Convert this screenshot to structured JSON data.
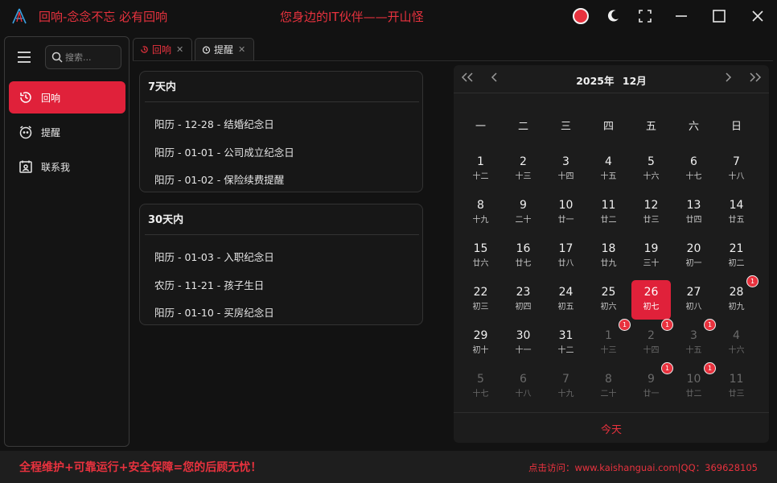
{
  "window": {
    "title": "回响-念念不忘 必有回响",
    "slogan": "您身边的IT伙伴——开山怪"
  },
  "colors": {
    "accent": "#e0213a",
    "background": "#121212"
  },
  "sidebar": {
    "search_placeholder": "搜索...",
    "items": [
      {
        "label": "回响",
        "icon": "clock-icon",
        "active": true
      },
      {
        "label": "提醒",
        "icon": "alarm-icon",
        "active": false
      },
      {
        "label": "联系我",
        "icon": "contact-icon",
        "active": false
      }
    ]
  },
  "tabs": [
    {
      "label": "回响",
      "active": true
    },
    {
      "label": "提醒",
      "active": false
    }
  ],
  "sections": [
    {
      "title": "7天内",
      "items": [
        "阳历 - 12-28 - 结婚纪念日",
        "阳历 - 01-01 - 公司成立纪念日",
        "阳历 - 01-02 - 保险续费提醒"
      ]
    },
    {
      "title": "30天内",
      "items": [
        "阳历 - 01-03 - 入职纪念日",
        "农历 - 11-21 - 孩子生日",
        "阳历 - 01-10 - 买房纪念日"
      ]
    }
  ],
  "calendar": {
    "year": "2025年",
    "month": "12月",
    "weekdays": [
      "一",
      "二",
      "三",
      "四",
      "五",
      "六",
      "日"
    ],
    "days": [
      [
        {
          "d": "1",
          "l": "十二"
        },
        {
          "d": "2",
          "l": "十三"
        },
        {
          "d": "3",
          "l": "十四"
        },
        {
          "d": "4",
          "l": "十五"
        },
        {
          "d": "5",
          "l": "十六"
        },
        {
          "d": "6",
          "l": "十七"
        },
        {
          "d": "7",
          "l": "十八"
        }
      ],
      [
        {
          "d": "8",
          "l": "十九"
        },
        {
          "d": "9",
          "l": "二十"
        },
        {
          "d": "10",
          "l": "廿一"
        },
        {
          "d": "11",
          "l": "廿二"
        },
        {
          "d": "12",
          "l": "廿三"
        },
        {
          "d": "13",
          "l": "廿四"
        },
        {
          "d": "14",
          "l": "廿五"
        }
      ],
      [
        {
          "d": "15",
          "l": "廿六"
        },
        {
          "d": "16",
          "l": "廿七"
        },
        {
          "d": "17",
          "l": "廿八"
        },
        {
          "d": "18",
          "l": "廿九"
        },
        {
          "d": "19",
          "l": "三十"
        },
        {
          "d": "20",
          "l": "初一"
        },
        {
          "d": "21",
          "l": "初二"
        }
      ],
      [
        {
          "d": "22",
          "l": "初三"
        },
        {
          "d": "23",
          "l": "初四"
        },
        {
          "d": "24",
          "l": "初五"
        },
        {
          "d": "25",
          "l": "初六"
        },
        {
          "d": "26",
          "l": "初七",
          "selected": true
        },
        {
          "d": "27",
          "l": "初八"
        },
        {
          "d": "28",
          "l": "初九",
          "badge": "1"
        }
      ],
      [
        {
          "d": "29",
          "l": "初十"
        },
        {
          "d": "30",
          "l": "十一"
        },
        {
          "d": "31",
          "l": "十二"
        },
        {
          "d": "1",
          "l": "十三",
          "other": true,
          "badge": "1"
        },
        {
          "d": "2",
          "l": "十四",
          "other": true,
          "badge": "1"
        },
        {
          "d": "3",
          "l": "十五",
          "other": true,
          "badge": "1"
        },
        {
          "d": "4",
          "l": "十六",
          "other": true
        }
      ],
      [
        {
          "d": "5",
          "l": "十七",
          "other": true
        },
        {
          "d": "6",
          "l": "十八",
          "other": true
        },
        {
          "d": "7",
          "l": "十九",
          "other": true
        },
        {
          "d": "8",
          "l": "二十",
          "other": true
        },
        {
          "d": "9",
          "l": "廿一",
          "other": true,
          "badge": "1"
        },
        {
          "d": "10",
          "l": "廿二",
          "other": true,
          "badge": "1"
        },
        {
          "d": "11",
          "l": "廿三",
          "other": true
        }
      ]
    ],
    "today_label": "今天"
  },
  "footer": {
    "left": "全程维护+可靠运行+安全保障=您的后顾无忧！",
    "right": "点击访问：www.kaishanguai.com|QQ：369628105"
  }
}
